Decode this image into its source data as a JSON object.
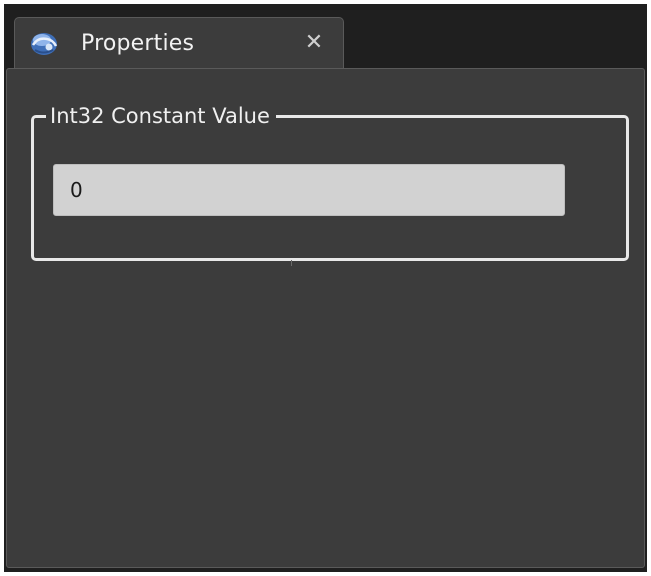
{
  "tab": {
    "title": "Properties",
    "icon": "properties-app-icon",
    "close_glyph": "✕"
  },
  "group": {
    "legend": "Int32 Constant Value",
    "input_value": "0"
  },
  "colors": {
    "window_bg": "#1f1f1f",
    "panel_bg": "#3c3c3c",
    "border_light": "#e8e8e8",
    "input_bg": "#d2d2d2",
    "text_light": "#f2f2f2"
  }
}
